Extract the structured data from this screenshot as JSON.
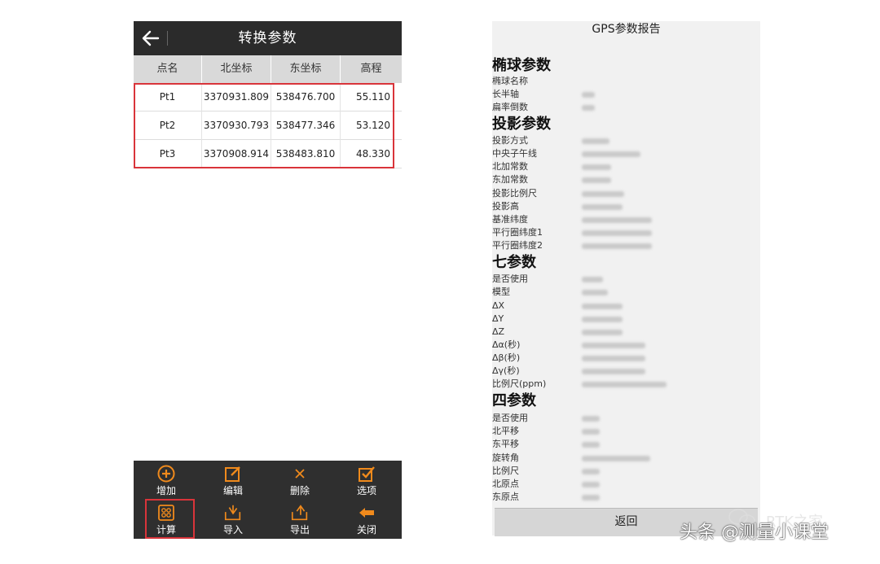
{
  "left": {
    "title": "转换参数",
    "columns": [
      "点名",
      "北坐标",
      "东坐标",
      "高程"
    ],
    "rows": [
      {
        "name": "Pt1",
        "north": "3370931.809",
        "east": "538476.700",
        "elev": "55.110"
      },
      {
        "name": "Pt2",
        "north": "3370930.793",
        "east": "538477.346",
        "elev": "53.120"
      },
      {
        "name": "Pt3",
        "north": "3370908.914",
        "east": "538483.810",
        "elev": "48.330"
      }
    ],
    "toolbar": {
      "add": "增加",
      "edit": "编辑",
      "delete": "删除",
      "options": "选项",
      "calculate": "计算",
      "import": "导入",
      "export": "导出",
      "close": "关闭"
    },
    "accent": "#f08a1c",
    "highlight": "#d9343a"
  },
  "report": {
    "title": "GPS参数报告",
    "ellipsoid": {
      "heading": "椭球参数",
      "labels": [
        "椭球名称",
        "长半轴",
        "扁率倒数"
      ]
    },
    "projection": {
      "heading": "投影参数",
      "labels": [
        "投影方式",
        "中央子午线",
        "北加常数",
        "东加常数",
        "投影比例尺",
        "投影高",
        "基准纬度",
        "平行圈纬度1",
        "平行圈纬度2"
      ]
    },
    "seven": {
      "heading": "七参数",
      "labels": [
        "是否使用",
        "模型",
        "ΔX",
        "ΔY",
        "ΔZ",
        "Δα(秒)",
        "Δβ(秒)",
        "Δγ(秒)",
        "比例尺(ppm)"
      ]
    },
    "four": {
      "heading": "四参数",
      "labels": [
        "是否使用",
        "北平移",
        "东平移",
        "旋转角",
        "比例尺",
        "北原点",
        "东原点"
      ]
    },
    "return_label": "返回"
  },
  "watermark": {
    "text": "头条 @测量小课堂",
    "faint": "RTK之家"
  }
}
